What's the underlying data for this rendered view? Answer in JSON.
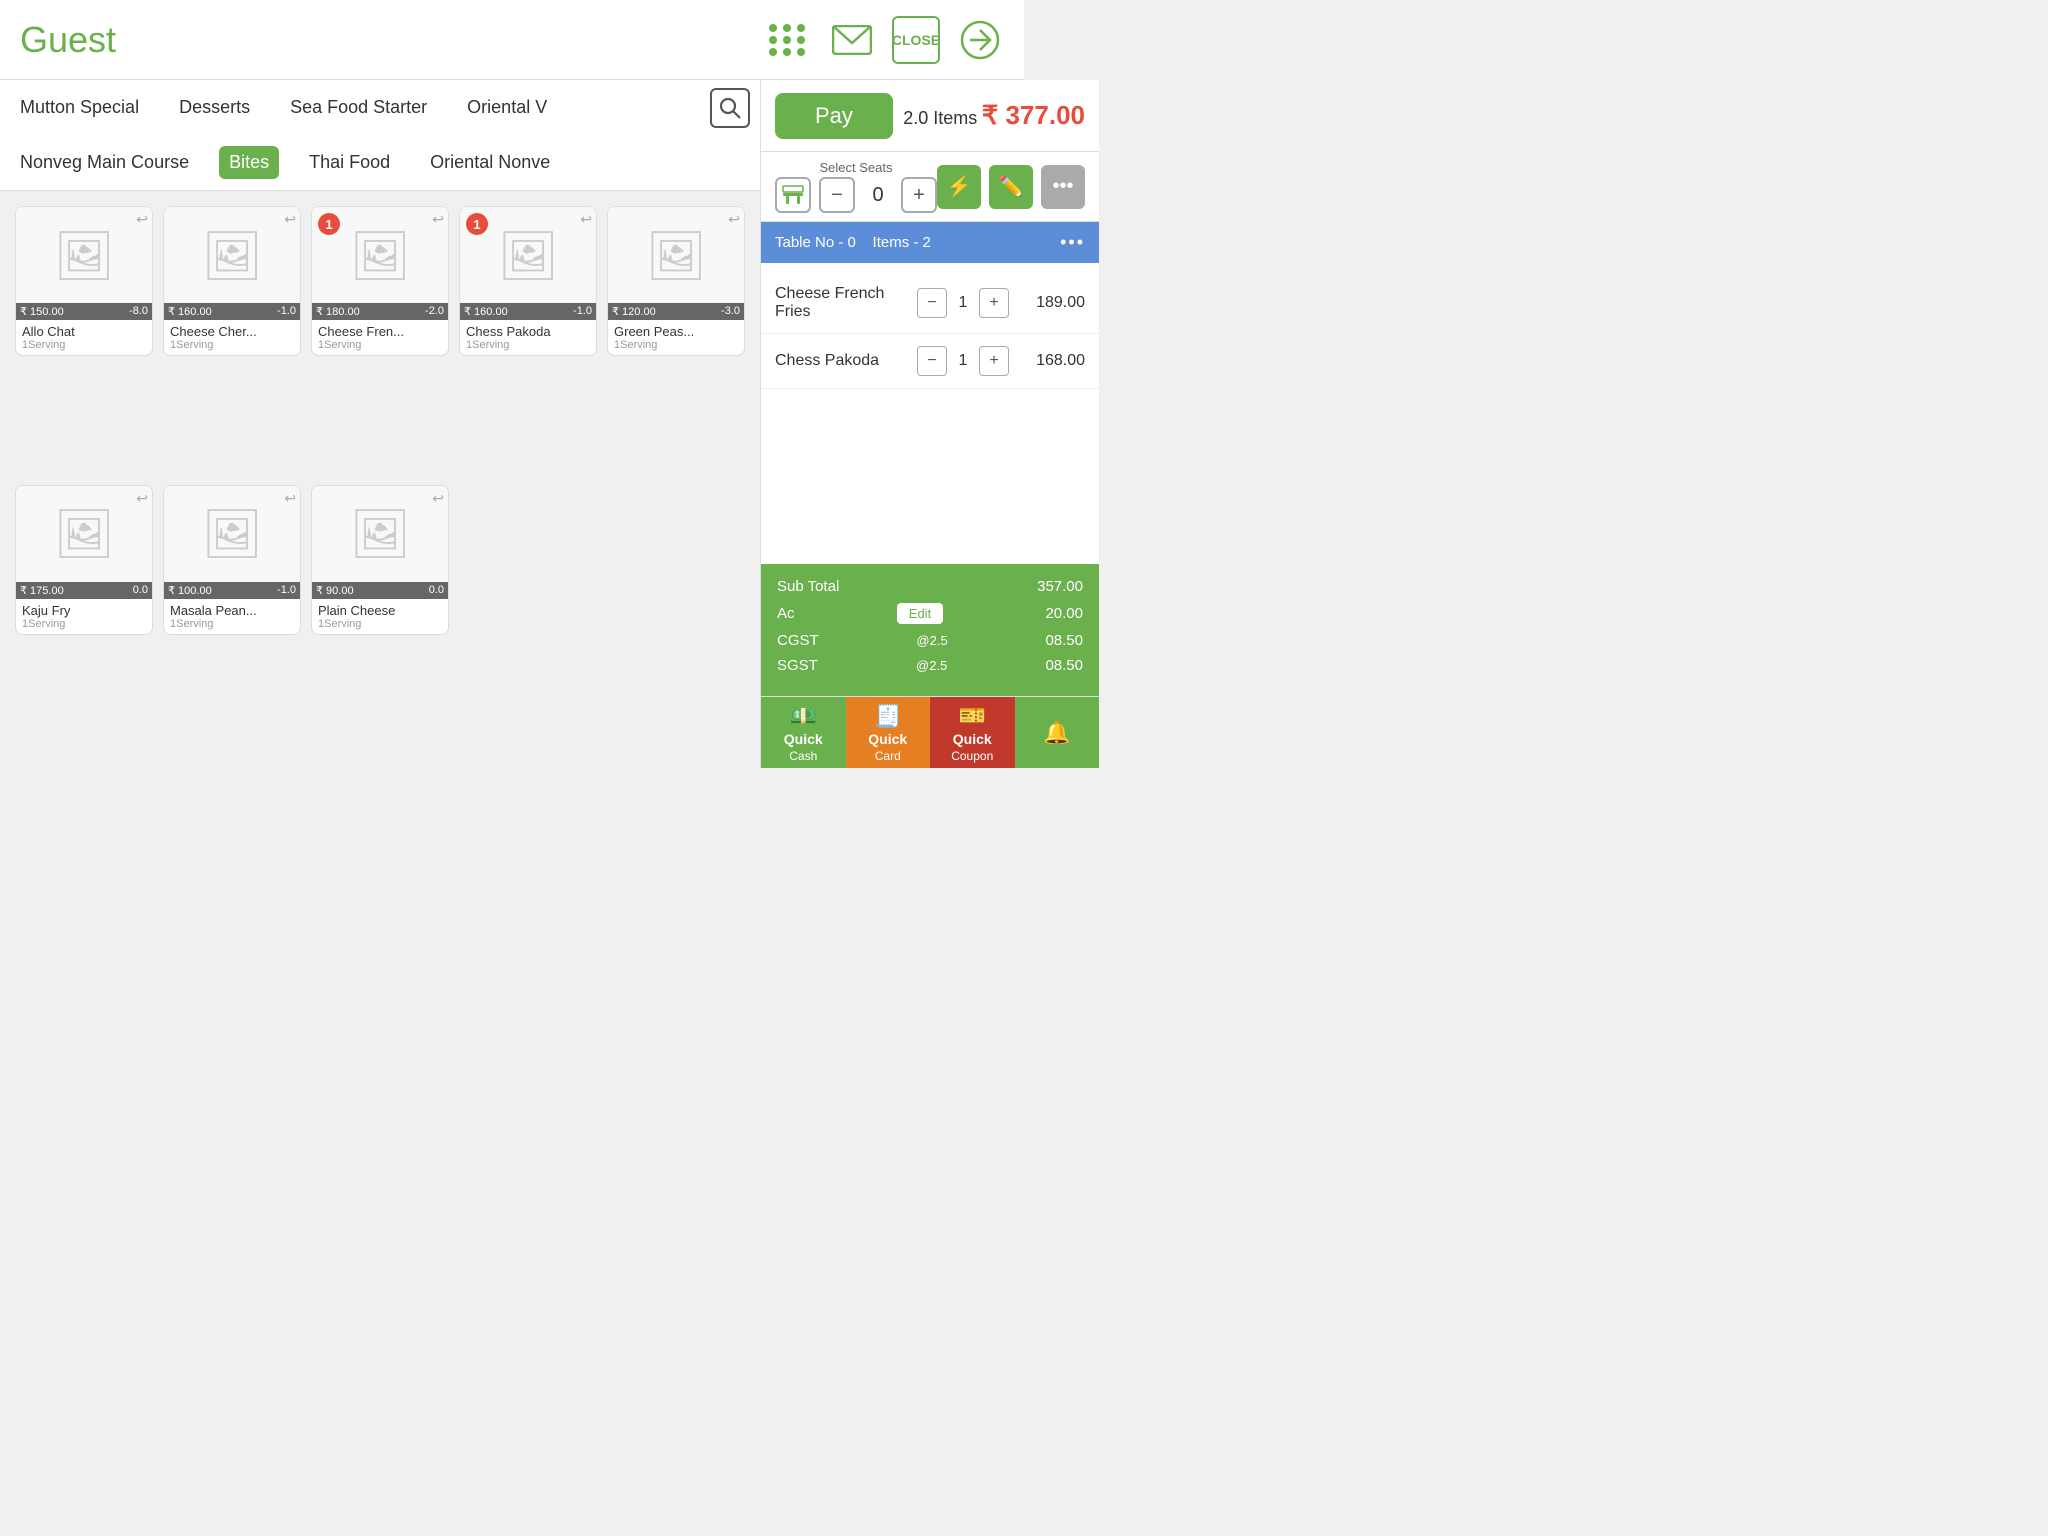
{
  "header": {
    "title": "Guest",
    "close_label": "CLOSE"
  },
  "categories_row1": [
    {
      "label": "Mutton Special",
      "active": false
    },
    {
      "label": "Desserts",
      "active": false
    },
    {
      "label": "Sea Food Starter",
      "active": false
    },
    {
      "label": "Oriental V",
      "active": false
    }
  ],
  "categories_row2": [
    {
      "label": "Nonveg Main Course",
      "active": false
    },
    {
      "label": "Bites",
      "active": true
    },
    {
      "label": "Thai Food",
      "active": false
    },
    {
      "label": "Oriental Nonve",
      "active": false
    }
  ],
  "items": [
    {
      "name": "Allo Chat",
      "serving": "1Serving",
      "price": "₹ 150.00",
      "stock": "-8.0",
      "badge": null
    },
    {
      "name": "Cheese Cher...",
      "serving": "1Serving",
      "price": "₹ 160.00",
      "stock": "-1.0",
      "badge": null
    },
    {
      "name": "Cheese Fren...",
      "serving": "1Serving",
      "price": "₹ 180.00",
      "stock": "-2.0",
      "badge": "1"
    },
    {
      "name": "Chess Pakoda",
      "serving": "1Serving",
      "price": "₹ 160.00",
      "stock": "-1.0",
      "badge": "1"
    },
    {
      "name": "Green Peas...",
      "serving": "1Serving",
      "price": "₹ 120.00",
      "stock": "-3.0",
      "badge": null
    },
    {
      "name": "Kaju Fry",
      "serving": "1Serving",
      "price": "₹ 175.00",
      "stock": "0.0",
      "badge": null
    },
    {
      "name": "Masala Pean...",
      "serving": "1Serving",
      "price": "₹ 100.00",
      "stock": "-1.0",
      "badge": null
    },
    {
      "name": "Plain Cheese",
      "serving": "1Serving",
      "price": "₹ 90.00",
      "stock": "0.0",
      "badge": null
    }
  ],
  "pay": {
    "label": "Pay",
    "items_count": "2.0 Items",
    "total": "₹ 377.00"
  },
  "seats": {
    "label": "Select Seats",
    "value": "0"
  },
  "table": {
    "no": "Table No - 0",
    "items": "Items - 2"
  },
  "order_items": [
    {
      "name": "Cheese French Fries",
      "qty": "1",
      "price": "189.00"
    },
    {
      "name": "Chess Pakoda",
      "qty": "1",
      "price": "168.00"
    }
  ],
  "summary": {
    "sub_total_label": "Sub Total",
    "sub_total_value": "357.00",
    "ac_label": "Ac",
    "ac_edit": "Edit",
    "ac_value": "20.00",
    "cgst_label": "CGST",
    "cgst_rate": "@2.5",
    "cgst_value": "08.50",
    "sgst_label": "SGST",
    "sgst_rate": "@2.5",
    "sgst_value": "08.50"
  },
  "quick_actions": [
    {
      "label": "Quick",
      "sublabel": "Cash",
      "color": "cash"
    },
    {
      "label": "Quick",
      "sublabel": "Card",
      "color": "card"
    },
    {
      "label": "Quick",
      "sublabel": "Coupon",
      "color": "coupon"
    },
    {
      "label": "",
      "sublabel": "",
      "color": "more"
    }
  ]
}
